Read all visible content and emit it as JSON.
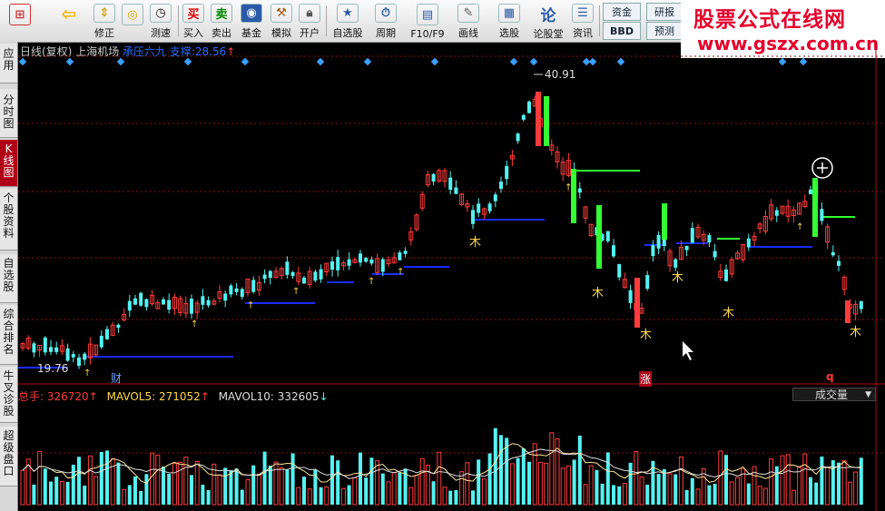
{
  "toolbar": {
    "buttons": [
      {
        "label": "",
        "icon": "app-logo-icon"
      },
      {
        "label": "",
        "icon": "back-arrow-icon"
      },
      {
        "label": "修正",
        "icon": "up-down-icon"
      },
      {
        "label": "测速",
        "icon": "speed-icon"
      },
      {
        "label": "",
        "icon": "clock-icon"
      },
      {
        "label": "买入",
        "icon": "buy-icon"
      },
      {
        "label": "卖出",
        "icon": "sell-icon"
      },
      {
        "label": "基金",
        "icon": "fund-icon"
      },
      {
        "label": "模拟",
        "icon": "hammer-icon"
      },
      {
        "label": "开户",
        "icon": "lock-icon"
      },
      {
        "label": "自选股",
        "icon": "star-icon"
      },
      {
        "label": "周期",
        "icon": "period-icon"
      },
      {
        "label": "F10/F9",
        "icon": "f10-icon"
      },
      {
        "label": "画线",
        "icon": "pencil-icon"
      },
      {
        "label": "选股",
        "icon": "select-stock-icon"
      },
      {
        "label": "论股堂",
        "icon": "forum-icon"
      },
      {
        "label": "资讯",
        "icon": "news-icon"
      }
    ],
    "fund_label": "资金",
    "research_label": "研报",
    "bbd_label": "BBD",
    "forecast_label": "预测"
  },
  "ad": {
    "line1": "股票公式在线网",
    "line2": "www.gszx.com.cn"
  },
  "sidebar": {
    "items": [
      "应用",
      "分时图",
      "K线图",
      "个股资料",
      "自选股",
      "综合排名",
      "牛叉诊股",
      "超级盘口"
    ]
  },
  "chart": {
    "title_prefix": "日线(复权)",
    "stock_name": "上海机场",
    "indicator_text": "承压六九 支撑:28.56",
    "indicator_arrow": "↑",
    "high_label": "40.91",
    "low_label": "19.76",
    "marker_cai": "财",
    "marker_zhang": "涨",
    "marker_q": "q",
    "signal_glyph": "木"
  },
  "volume": {
    "total_label": "总手: 326720",
    "total_arrow": "↑",
    "mavol5_label": "MAVOL5: 271052",
    "mavol5_arrow": "↑",
    "mavol10_label": "MAVOL10: 332605",
    "mavol10_arrow": "↓",
    "selector": "成交量"
  },
  "colors": {
    "up": "#ff3b3b",
    "down": "#54f2f2",
    "buy_signal": "#33ff33",
    "support_line": "#1a2cff",
    "resist_line": "#33ff33",
    "signal": "#ffd84a",
    "diamond": "#3aa0ff",
    "grid": "#8a1010"
  }
}
